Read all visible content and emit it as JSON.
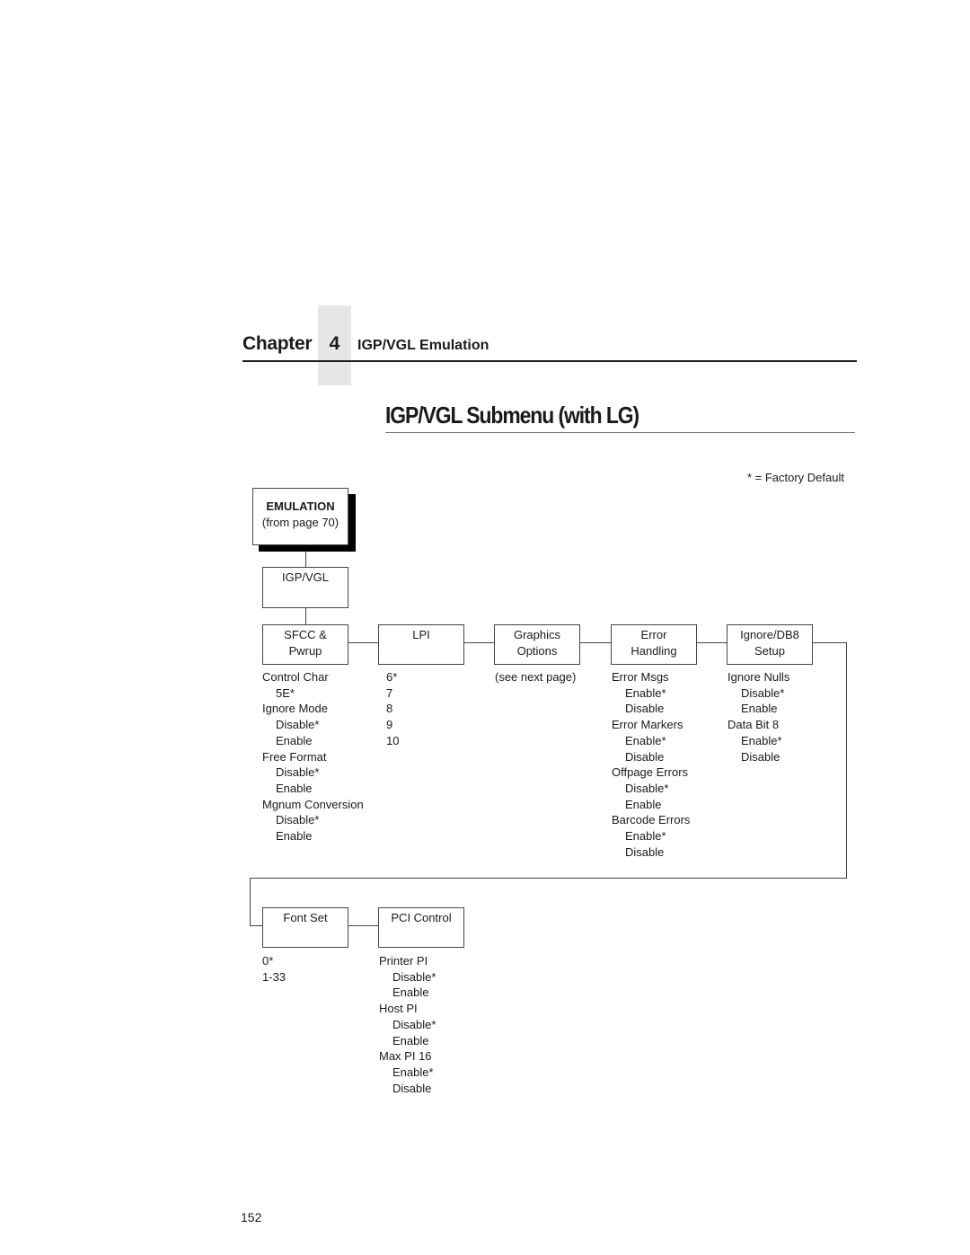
{
  "header": {
    "chapter_word": "Chapter",
    "chapter_number": "4",
    "chapter_title": "IGP/VGL Emulation"
  },
  "page_title": "IGP/VGL Submenu (with LG)",
  "legend": "* = Factory Default",
  "diagram": {
    "root": {
      "title": "EMULATION",
      "subtitle": "(from page 70)"
    },
    "submenu": {
      "label": "IGP/VGL"
    },
    "row1": [
      {
        "label_l1": "SFCC &",
        "label_l2": "Pwrup",
        "options": [
          {
            "text": "Control Char",
            "indent": false
          },
          {
            "text": "5E*",
            "indent": true
          },
          {
            "text": "Ignore Mode",
            "indent": false
          },
          {
            "text": "Disable*",
            "indent": true
          },
          {
            "text": "Enable",
            "indent": true
          },
          {
            "text": "Free Format",
            "indent": false
          },
          {
            "text": "Disable*",
            "indent": true
          },
          {
            "text": "Enable",
            "indent": true
          },
          {
            "text": "Mgnum Conversion",
            "indent": false
          },
          {
            "text": "Disable*",
            "indent": true
          },
          {
            "text": "Enable",
            "indent": true
          }
        ]
      },
      {
        "label_l1": "LPI",
        "label_l2": "",
        "options": [
          {
            "text": "6*",
            "indent": false
          },
          {
            "text": "7",
            "indent": false
          },
          {
            "text": "8",
            "indent": false
          },
          {
            "text": "9",
            "indent": false
          },
          {
            "text": "10",
            "indent": false
          }
        ]
      },
      {
        "label_l1": "Graphics",
        "label_l2": "Options",
        "options": [
          {
            "text": "(see next page)",
            "indent": false
          }
        ]
      },
      {
        "label_l1": "Error",
        "label_l2": "Handling",
        "options": [
          {
            "text": "Error Msgs",
            "indent": false
          },
          {
            "text": "Enable*",
            "indent": true
          },
          {
            "text": "Disable",
            "indent": true
          },
          {
            "text": "Error Markers",
            "indent": false
          },
          {
            "text": "Enable*",
            "indent": true
          },
          {
            "text": "Disable",
            "indent": true
          },
          {
            "text": "Offpage Errors",
            "indent": false
          },
          {
            "text": "Disable*",
            "indent": true
          },
          {
            "text": "Enable",
            "indent": true
          },
          {
            "text": "Barcode Errors",
            "indent": false
          },
          {
            "text": "Enable*",
            "indent": true
          },
          {
            "text": "Disable",
            "indent": true
          }
        ]
      },
      {
        "label_l1": "Ignore/DB8",
        "label_l2": "Setup",
        "options": [
          {
            "text": "Ignore Nulls",
            "indent": false
          },
          {
            "text": "Disable*",
            "indent": true
          },
          {
            "text": "Enable",
            "indent": true
          },
          {
            "text": "Data Bit 8",
            "indent": false
          },
          {
            "text": "Enable*",
            "indent": true
          },
          {
            "text": "Disable",
            "indent": true
          }
        ]
      }
    ],
    "row2": [
      {
        "label_l1": "Font Set",
        "label_l2": "",
        "options": [
          {
            "text": "0*",
            "indent": false
          },
          {
            "text": "1-33",
            "indent": false
          }
        ]
      },
      {
        "label_l1": "PCI Control",
        "label_l2": "",
        "options": [
          {
            "text": "Printer PI",
            "indent": false
          },
          {
            "text": "Disable*",
            "indent": true
          },
          {
            "text": "Enable",
            "indent": true
          },
          {
            "text": "Host PI",
            "indent": false
          },
          {
            "text": "Disable*",
            "indent": true
          },
          {
            "text": "Enable",
            "indent": true
          },
          {
            "text": "Max PI 16",
            "indent": false
          },
          {
            "text": "Enable*",
            "indent": true
          },
          {
            "text": "Disable",
            "indent": true
          }
        ]
      }
    ]
  },
  "page_number": "152"
}
